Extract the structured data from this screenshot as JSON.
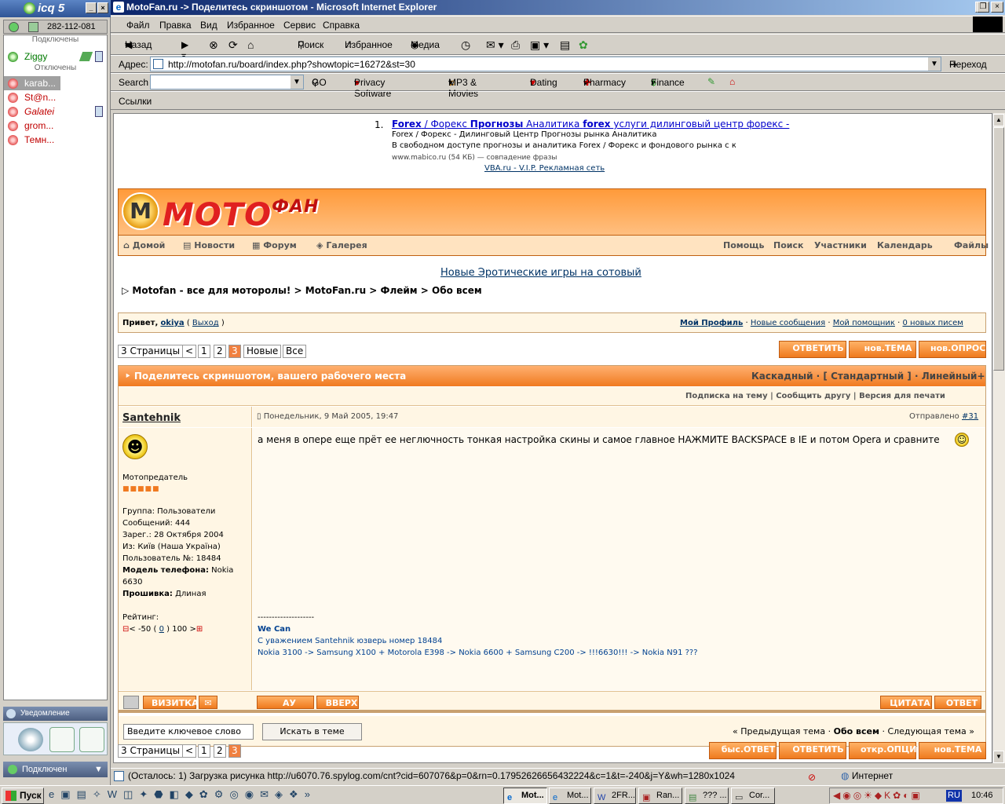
{
  "icq": {
    "title": "icq 5",
    "uin": "282-112-081",
    "group_online": "Подключены",
    "group_offline": "Отключены",
    "online": [
      {
        "name": "Ziggy"
      }
    ],
    "offline": [
      {
        "name": "karab..."
      },
      {
        "name": "St@n..."
      },
      {
        "name": "Galatei"
      },
      {
        "name": "grom..."
      },
      {
        "name": "Темн..."
      }
    ],
    "notify": "Уведомление",
    "status": "Подключен"
  },
  "ie": {
    "title": "MotoFan.ru -> Поделитесь скриншотом - Microsoft Internet Explorer",
    "menu": [
      "Файл",
      "Правка",
      "Вид",
      "Избранное",
      "Сервис",
      "Справка"
    ],
    "toolbar": {
      "back": "Назад",
      "search": "Поиск",
      "favorites": "Избранное",
      "media": "Медиа"
    },
    "address_label": "Адрес:",
    "address": "http://motofan.ru/board/index.php?showtopic=16272&st=30",
    "go": "Переход",
    "search_label": "Search",
    "search_go": "GO",
    "links": [
      "Privacy Software",
      "MP3 & Movies",
      "Dating",
      "Pharmacy",
      "Finance"
    ],
    "links_label": "Ссылки",
    "statusbar": "(Осталось: 1) Загрузка рисунка http://u6070.76.spylog.com/cnt?cid=607076&p=0&rn=0.17952626656432224&c=1&t=-240&j=Y&wh=1280x1024",
    "zone": "Интернет"
  },
  "ad": {
    "num": "1.",
    "title_a": "Forex",
    "title_b": "/ Форекс",
    "title_c": "Прогнозы",
    "title_d": "Аналитика",
    "title_e": "forex",
    "title_f": "услуги дилинговый центр форекс -",
    "l1": "Forex / Форекс - Дилинговый Центр Прогнозы рынка Аналитика",
    "l2": "В свободном доступе прогнозы и аналитика Forex / Форекс и фондового рынка с конкр",
    "l3": "www.mabico.ru (54 КБ) — совпадение фразы",
    "vba": "VBA.ru - V.I.P. Рекламная сеть"
  },
  "forum": {
    "nav": [
      "Домой",
      "Новости",
      "Форум",
      "Галерея"
    ],
    "nav_right": [
      "Помощь",
      "Поиск",
      "Участники",
      "Календарь",
      "Файлы"
    ],
    "promo": "Новые Эротические игры на сотовый",
    "crumbs": [
      "Motofan - все для моторолы!",
      "MotoFan.ru",
      "Флейм",
      "Обо всем"
    ],
    "hello": "Привет,",
    "user": "okiya",
    "logout": "Выход",
    "profile": [
      "Мой Профиль",
      "Новые сообщения",
      "Мой помощник",
      "0 новых писем"
    ],
    "pages": "3 Страницы",
    "pages_nav": [
      "<",
      "1",
      "2",
      "3",
      "Новые",
      "Все"
    ],
    "buttons_top": [
      "ОТВЕТИТЬ",
      "нов.ТЕМА",
      "нов.ОПРОС"
    ],
    "topic": "Поделитесь скриншотом, вашего рабочего места",
    "modes": "Каскадный · [ Стандартный ] · Линейный+",
    "subs": "Подписка на тему",
    "tell": "Сообщить другу",
    "print": "Версия для печати",
    "post": {
      "author": "Santehnik",
      "date": "Понедельник, 9 Май 2005, 19:47",
      "sent": "Отправлено",
      "num": "#31",
      "rank": "Мотопредатель",
      "info": [
        "Группа: Пользователи",
        "Сообщений: 444",
        "Зарег.: 28 Октября 2004",
        "Из: Київ (Наша Україна)",
        "Пользователь №: 18484"
      ],
      "phone_label": "Модель телефона:",
      "phone": "Nokia 6630",
      "fw_label": "Прошивка:",
      "fw": "Длиная",
      "rating_label": "Рейтинг:",
      "rating": "< -50 (",
      "rating_val": "0",
      "rating_end": ") 100 >",
      "text": "а меня в опере еще прёт ее неглючность тонкая настройка скины и самое главное НАЖМИТЕ BACKSPACE в IE и потом Opera и сравните",
      "sig_line": "--------------------",
      "sig1": "We Can",
      "sig2": "С уважением Santehnik юзверь номер 18484",
      "sig3": "Nokia 3100 -> Samsung X100 + Motorola E398 -> Nokia 6600 + Samsung C200 -> !!!6630!!! -> Nokia N91 ???",
      "btns_left": [
        "ВИЗИТКА"
      ],
      "btns_mid": [
        "АУ АДМИН",
        "ВВЕРХ"
      ],
      "btns_right": [
        "ЦИТАТА",
        "ОТВЕТ"
      ]
    },
    "search_placeholder": "Введите ключевое слово",
    "search_btn": "Искать в теме",
    "topic_nav": [
      "« Предыдущая тема",
      "Обо всем",
      "Следующая тема »"
    ],
    "buttons_bottom": [
      "быс.ОТВЕТ",
      "ОТВЕТИТЬ",
      "откр.ОПЦИИ",
      "нов.ТЕМА"
    ]
  },
  "taskbar": {
    "start": "Пуск",
    "tasks": [
      "Mot...",
      "Mot...",
      "2FR...",
      "Ran...",
      "??? ...",
      "Cor..."
    ],
    "lang": "RU",
    "clock": "10:46"
  }
}
